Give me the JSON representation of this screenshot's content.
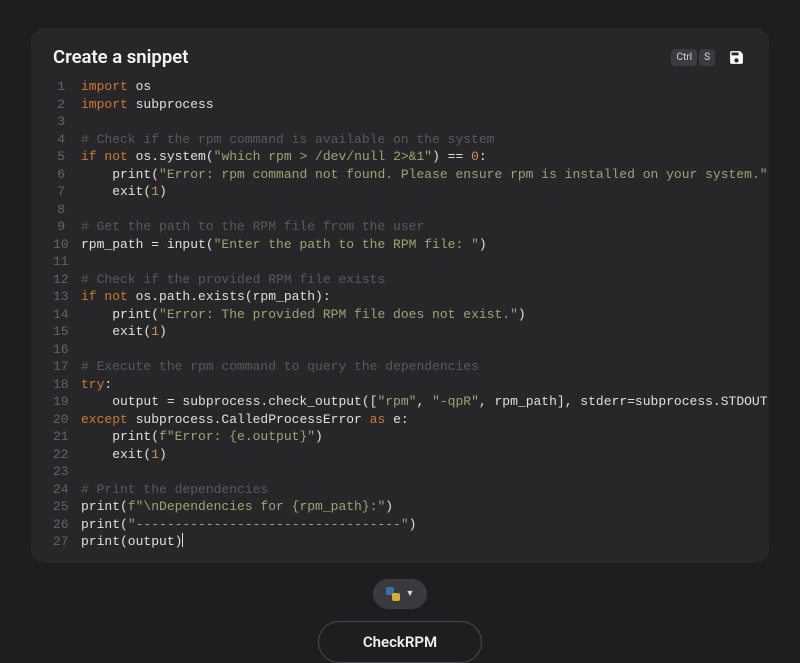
{
  "header": {
    "title": "Create a snippet",
    "shortcut_keys": [
      "Ctrl",
      "S"
    ]
  },
  "footer": {
    "language": "Python",
    "snippet_name": "CheckRPM"
  },
  "code_lines": [
    [
      {
        "t": "kw",
        "v": "import"
      },
      {
        "t": "pl",
        "v": " os"
      }
    ],
    [
      {
        "t": "kw",
        "v": "import"
      },
      {
        "t": "pl",
        "v": " subprocess"
      }
    ],
    [],
    [
      {
        "t": "cmt",
        "v": "# Check if the rpm command is available on the system"
      }
    ],
    [
      {
        "t": "kw",
        "v": "if not"
      },
      {
        "t": "pl",
        "v": " os.system("
      },
      {
        "t": "str",
        "v": "\"which rpm > /dev/null 2>&1\""
      },
      {
        "t": "pl",
        "v": ") == "
      },
      {
        "t": "num",
        "v": "0"
      },
      {
        "t": "pl",
        "v": ":"
      }
    ],
    [
      {
        "t": "pl",
        "v": "    print("
      },
      {
        "t": "str",
        "v": "\"Error: rpm command not found. Please ensure rpm is installed on your system.\""
      },
      {
        "t": "pl",
        "v": ")"
      }
    ],
    [
      {
        "t": "pl",
        "v": "    exit("
      },
      {
        "t": "num",
        "v": "1"
      },
      {
        "t": "pl",
        "v": ")"
      }
    ],
    [],
    [
      {
        "t": "cmt",
        "v": "# Get the path to the RPM file from the user"
      }
    ],
    [
      {
        "t": "pl",
        "v": "rpm_path = input("
      },
      {
        "t": "str",
        "v": "\"Enter the path to the RPM file: \""
      },
      {
        "t": "pl",
        "v": ")"
      }
    ],
    [],
    [
      {
        "t": "cmt",
        "v": "# Check if the provided RPM file exists"
      }
    ],
    [
      {
        "t": "kw",
        "v": "if not"
      },
      {
        "t": "pl",
        "v": " os.path.exists(rpm_path):"
      }
    ],
    [
      {
        "t": "pl",
        "v": "    print("
      },
      {
        "t": "str",
        "v": "\"Error: The provided RPM file does not exist.\""
      },
      {
        "t": "pl",
        "v": ")"
      }
    ],
    [
      {
        "t": "pl",
        "v": "    exit("
      },
      {
        "t": "num",
        "v": "1"
      },
      {
        "t": "pl",
        "v": ")"
      }
    ],
    [],
    [
      {
        "t": "cmt",
        "v": "# Execute the rpm command to query the dependencies"
      }
    ],
    [
      {
        "t": "kw",
        "v": "try"
      },
      {
        "t": "pl",
        "v": ":"
      }
    ],
    [
      {
        "t": "pl",
        "v": "    output = subprocess.check_output(["
      },
      {
        "t": "str",
        "v": "\"rpm\""
      },
      {
        "t": "pl",
        "v": ", "
      },
      {
        "t": "str",
        "v": "\"-qpR\""
      },
      {
        "t": "pl",
        "v": ", rpm_path], stderr=subprocess.STDOUT, text"
      }
    ],
    [
      {
        "t": "kw",
        "v": "except"
      },
      {
        "t": "pl",
        "v": " subprocess.CalledProcessError "
      },
      {
        "t": "kw",
        "v": "as"
      },
      {
        "t": "pl",
        "v": " e:"
      }
    ],
    [
      {
        "t": "pl",
        "v": "    print("
      },
      {
        "t": "str",
        "v": "f\"Error: {e.output}\""
      },
      {
        "t": "pl",
        "v": ")"
      }
    ],
    [
      {
        "t": "pl",
        "v": "    exit("
      },
      {
        "t": "num",
        "v": "1"
      },
      {
        "t": "pl",
        "v": ")"
      }
    ],
    [],
    [
      {
        "t": "cmt",
        "v": "# Print the dependencies"
      }
    ],
    [
      {
        "t": "pl",
        "v": "print("
      },
      {
        "t": "str",
        "v": "f\"\\nDependencies for {rpm_path}:\""
      },
      {
        "t": "pl",
        "v": ")"
      }
    ],
    [
      {
        "t": "pl",
        "v": "print("
      },
      {
        "t": "str",
        "v": "\"----------------------------------\""
      },
      {
        "t": "pl",
        "v": ")"
      }
    ],
    [
      {
        "t": "pl",
        "v": "print(output)"
      }
    ]
  ]
}
